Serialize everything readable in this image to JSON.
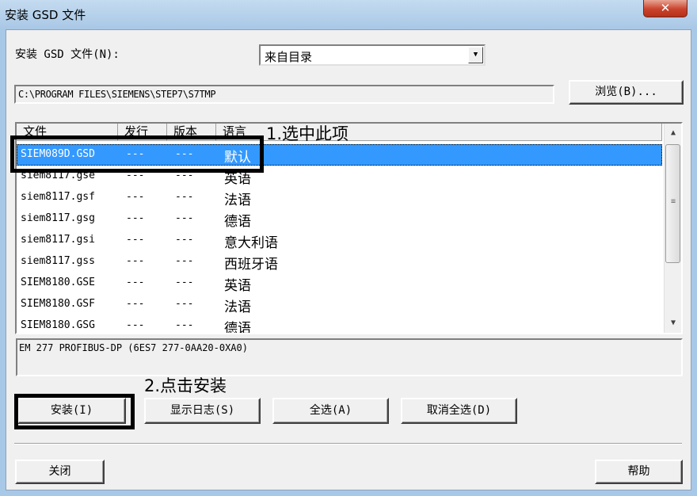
{
  "window": {
    "title": "安装 GSD 文件",
    "close_symbol": "✕"
  },
  "install_from": {
    "label": "安装 GSD 文件(N):",
    "selected": "来自目录"
  },
  "path": {
    "value": "C:\\PROGRAM FILES\\SIEMENS\\STEP7\\S7TMP"
  },
  "browse_button": "浏览(B)...",
  "list": {
    "columns": [
      "文件",
      "发行",
      "版本",
      "语言"
    ],
    "rows": [
      {
        "file": "SIEM089D.GSD",
        "release": "---",
        "version": "---",
        "language": "默认",
        "selected": true
      },
      {
        "file": "siem8117.gse",
        "release": "---",
        "version": "---",
        "language": "英语"
      },
      {
        "file": "siem8117.gsf",
        "release": "---",
        "version": "---",
        "language": "法语"
      },
      {
        "file": "siem8117.gsg",
        "release": "---",
        "version": "---",
        "language": "德语"
      },
      {
        "file": "siem8117.gsi",
        "release": "---",
        "version": "---",
        "language": "意大利语"
      },
      {
        "file": "siem8117.gss",
        "release": "---",
        "version": "---",
        "language": "西班牙语"
      },
      {
        "file": "SIEM8180.GSE",
        "release": "---",
        "version": "---",
        "language": "英语"
      },
      {
        "file": "SIEM8180.GSF",
        "release": "---",
        "version": "---",
        "language": "法语"
      },
      {
        "file": "SIEM8180.GSG",
        "release": "---",
        "version": "---",
        "language": "德语"
      }
    ]
  },
  "description": "EM 277 PROFIBUS-DP (6ES7 277-0AA20-0XA0)",
  "buttons": {
    "install": "安装(I)",
    "show_log": "显示日志(S)",
    "select_all": "全选(A)",
    "deselect_all": "取消全选(D)",
    "close": "关闭",
    "help": "帮助"
  },
  "annotations": {
    "step1": "1.选中此项",
    "step2": "2.点击安装"
  },
  "colors": {
    "selection": "#3399ff",
    "title_bar": "#a9c8e6",
    "close_button": "#c9432d"
  }
}
